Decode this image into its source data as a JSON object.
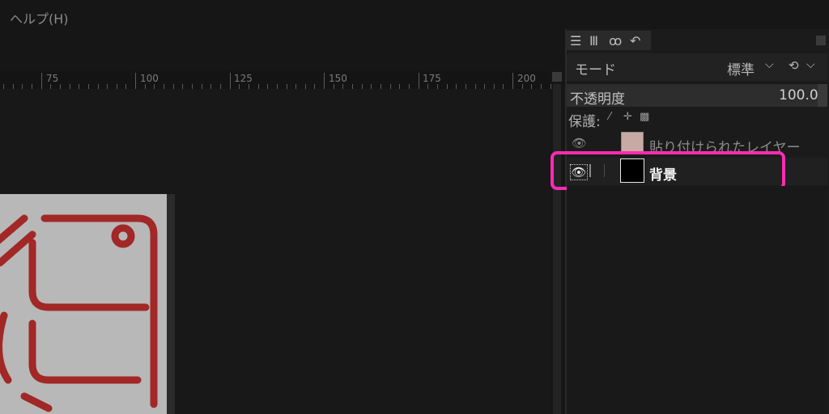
{
  "menubar": {
    "help_label": "ヘルプ(H)"
  },
  "ruler": {
    "ticks": [
      "75",
      "100",
      "125",
      "150",
      "175",
      "200"
    ]
  },
  "panel": {
    "tab_icons": [
      "layers-icon",
      "channels-icon",
      "paths-icon",
      "undo-icon"
    ],
    "mode_label": "モード",
    "mode_value": "標準",
    "opacity_label": "不透明度",
    "opacity_value": "100.0",
    "lock_label": "保護:",
    "lock_icons": [
      "pixel-lock-icon",
      "position-lock-icon",
      "alpha-lock-icon"
    ],
    "layers": [
      {
        "name": "貼り付けられたレイヤー",
        "visible": true,
        "selected": false
      },
      {
        "name": "背景",
        "visible": true,
        "selected": true
      }
    ]
  },
  "colors": {
    "highlight": "#ff2bb0",
    "stamp_red": "#a01818"
  }
}
